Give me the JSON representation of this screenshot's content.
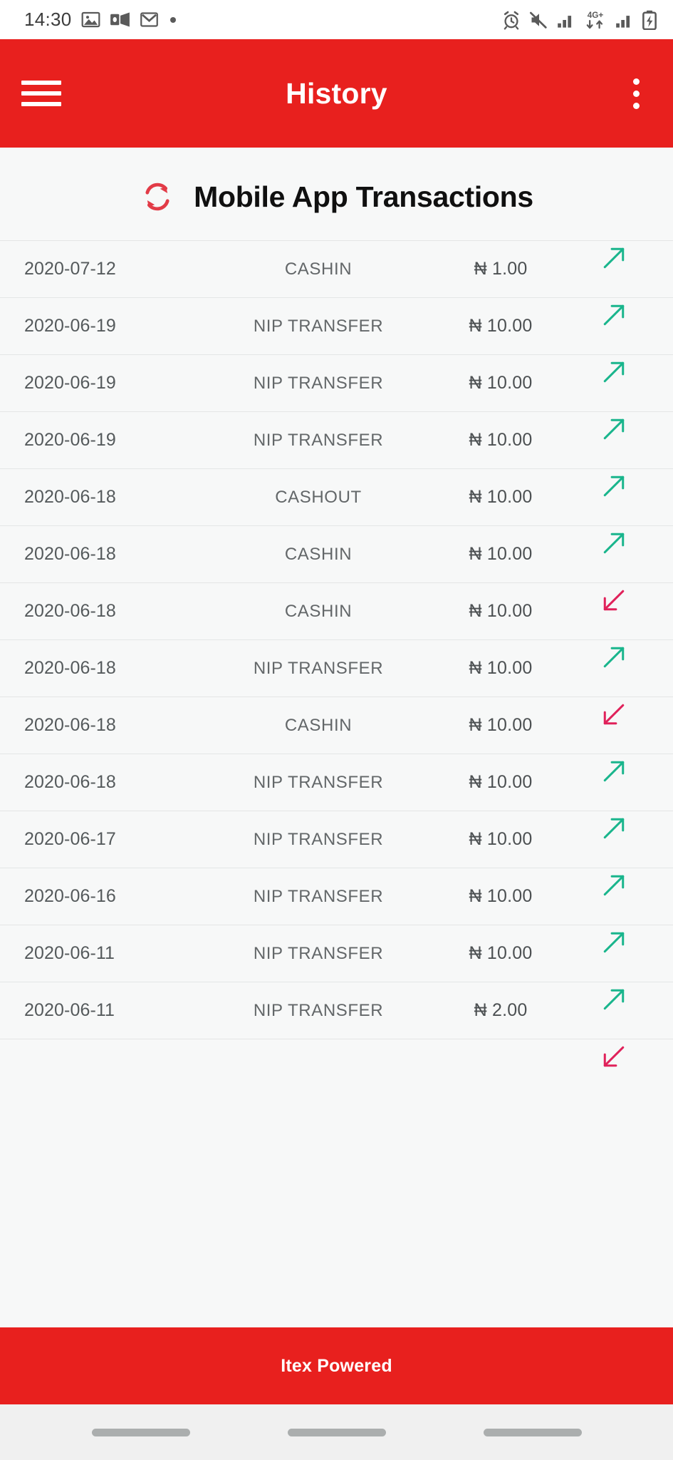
{
  "status_bar": {
    "time": "14:30",
    "left_icons": [
      "photos-icon",
      "outlook-icon",
      "gmail-icon",
      "notification-dot"
    ],
    "right_icons": [
      "alarm-icon",
      "volume-mute-icon",
      "signal-bars-icon",
      "network-4g-plus-icon",
      "signal-bars-2-icon",
      "battery-charging-icon"
    ],
    "network_label": "4G+"
  },
  "app_bar": {
    "menu_icon": "hamburger-menu-icon",
    "title": "History",
    "overflow_icon": "kebab-menu-icon",
    "background_color": "#E8201E"
  },
  "page": {
    "heading": "Mobile App Transactions",
    "heading_icon": "refresh-sync-icon",
    "heading_icon_color": "#E23B47",
    "background_color": "#F7F8F8"
  },
  "colors": {
    "brand_red": "#E8201E",
    "outgoing_arrow": "#19B58C",
    "incoming_arrow": "#E0215A",
    "row_divider": "#E4E6E6",
    "text_primary": "#555A5C",
    "text_secondary": "#636769"
  },
  "transactions": [
    {
      "date": "2020-07-12",
      "type": "CASHIN",
      "amount": "₦ 1.00",
      "direction": "up-right",
      "direction_icon": "arrow-up-right-icon"
    },
    {
      "date": "2020-06-19",
      "type": "NIP TRANSFER",
      "amount": "₦ 10.00",
      "direction": "up-right",
      "direction_icon": "arrow-up-right-icon"
    },
    {
      "date": "2020-06-19",
      "type": "NIP TRANSFER",
      "amount": "₦ 10.00",
      "direction": "up-right",
      "direction_icon": "arrow-up-right-icon"
    },
    {
      "date": "2020-06-19",
      "type": "NIP TRANSFER",
      "amount": "₦ 10.00",
      "direction": "up-right",
      "direction_icon": "arrow-up-right-icon"
    },
    {
      "date": "2020-06-18",
      "type": "CASHOUT",
      "amount": "₦ 10.00",
      "direction": "up-right",
      "direction_icon": "arrow-up-right-icon"
    },
    {
      "date": "2020-06-18",
      "type": "CASHIN",
      "amount": "₦ 10.00",
      "direction": "up-right",
      "direction_icon": "arrow-up-right-icon"
    },
    {
      "date": "2020-06-18",
      "type": "CASHIN",
      "amount": "₦ 10.00",
      "direction": "down-left",
      "direction_icon": "arrow-down-left-icon"
    },
    {
      "date": "2020-06-18",
      "type": "NIP TRANSFER",
      "amount": "₦ 10.00",
      "direction": "up-right",
      "direction_icon": "arrow-up-right-icon"
    },
    {
      "date": "2020-06-18",
      "type": "CASHIN",
      "amount": "₦ 10.00",
      "direction": "down-left",
      "direction_icon": "arrow-down-left-icon"
    },
    {
      "date": "2020-06-18",
      "type": "NIP TRANSFER",
      "amount": "₦ 10.00",
      "direction": "up-right",
      "direction_icon": "arrow-up-right-icon"
    },
    {
      "date": "2020-06-17",
      "type": "NIP TRANSFER",
      "amount": "₦ 10.00",
      "direction": "up-right",
      "direction_icon": "arrow-up-right-icon"
    },
    {
      "date": "2020-06-16",
      "type": "NIP TRANSFER",
      "amount": "₦ 10.00",
      "direction": "up-right",
      "direction_icon": "arrow-up-right-icon"
    },
    {
      "date": "2020-06-11",
      "type": "NIP TRANSFER",
      "amount": "₦ 10.00",
      "direction": "up-right",
      "direction_icon": "arrow-up-right-icon"
    },
    {
      "date": "2020-06-11",
      "type": "NIP TRANSFER",
      "amount": "₦ 2.00",
      "direction": "up-right",
      "direction_icon": "arrow-up-right-icon"
    },
    {
      "date": "",
      "type": "",
      "amount": "",
      "direction": "down-left",
      "direction_icon": "arrow-down-left-icon"
    }
  ],
  "footer": {
    "text": "Itex Powered"
  },
  "nav_bar": {
    "pills": 3
  }
}
